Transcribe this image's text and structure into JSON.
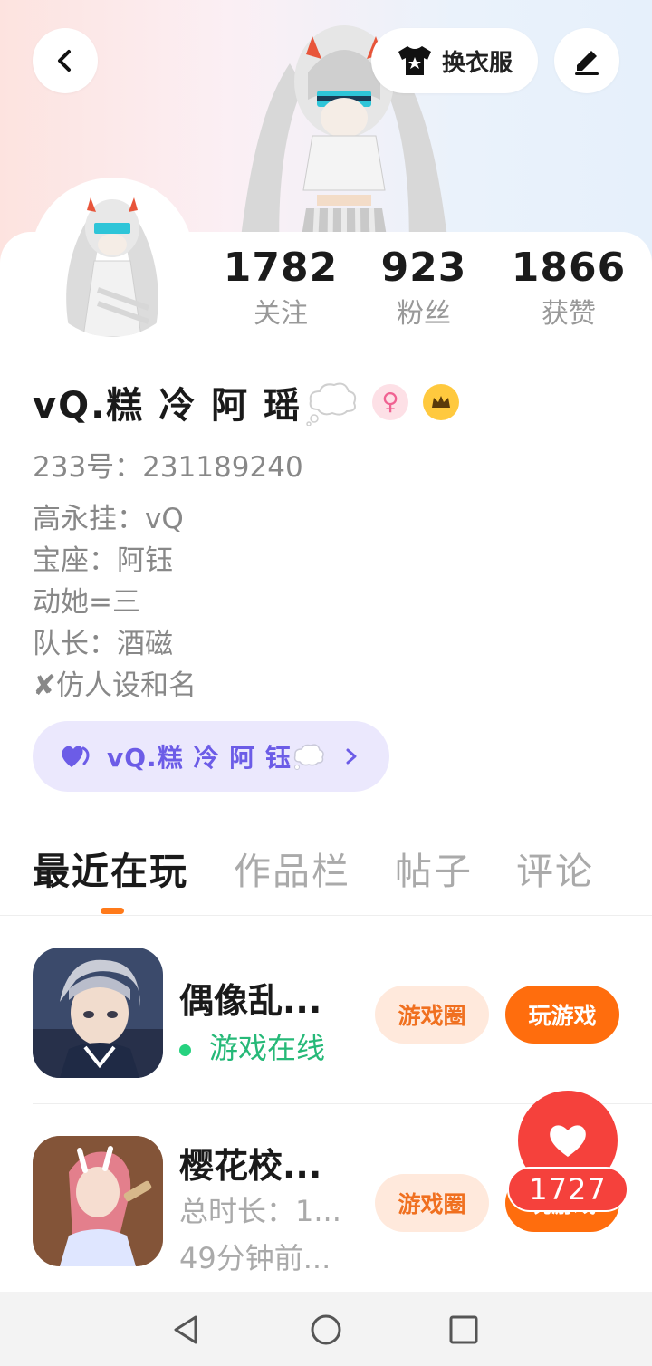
{
  "header": {
    "dress_label": "换衣服"
  },
  "stats": [
    {
      "value": "1782",
      "label": "关注"
    },
    {
      "value": "923",
      "label": "粉丝"
    },
    {
      "value": "1866",
      "label": "获赞"
    }
  ],
  "profile": {
    "name": "vQ.糕 冷 阿 瑶",
    "gender_symbol": "♀",
    "id_line": "233号：231189240",
    "bio": [
      "高永挂：vQ",
      "宝座：阿钰",
      "动她=三",
      "队长：酒磁",
      "✘仿人设和名"
    ],
    "group_pill": "vQ.糕 冷 阿 钰"
  },
  "tabs": [
    "最近在玩",
    "作品栏",
    "帖子",
    "评论"
  ],
  "games": [
    {
      "title": "偶像乱...",
      "status": "游戏在线",
      "circle_label": "游戏圈",
      "play_label": "玩游戏"
    },
    {
      "title": "樱花校...",
      "duration": "总时长：1...",
      "last_played": "49分钟前...",
      "circle_label": "游戏圈",
      "play_label": "玩游戏"
    }
  ],
  "like_float": {
    "count": "1727"
  },
  "colors": {
    "accent_orange": "#ff6d0d",
    "online_green": "#26b978",
    "like_red": "#f5413c",
    "group_purple": "#6c5ce7"
  }
}
